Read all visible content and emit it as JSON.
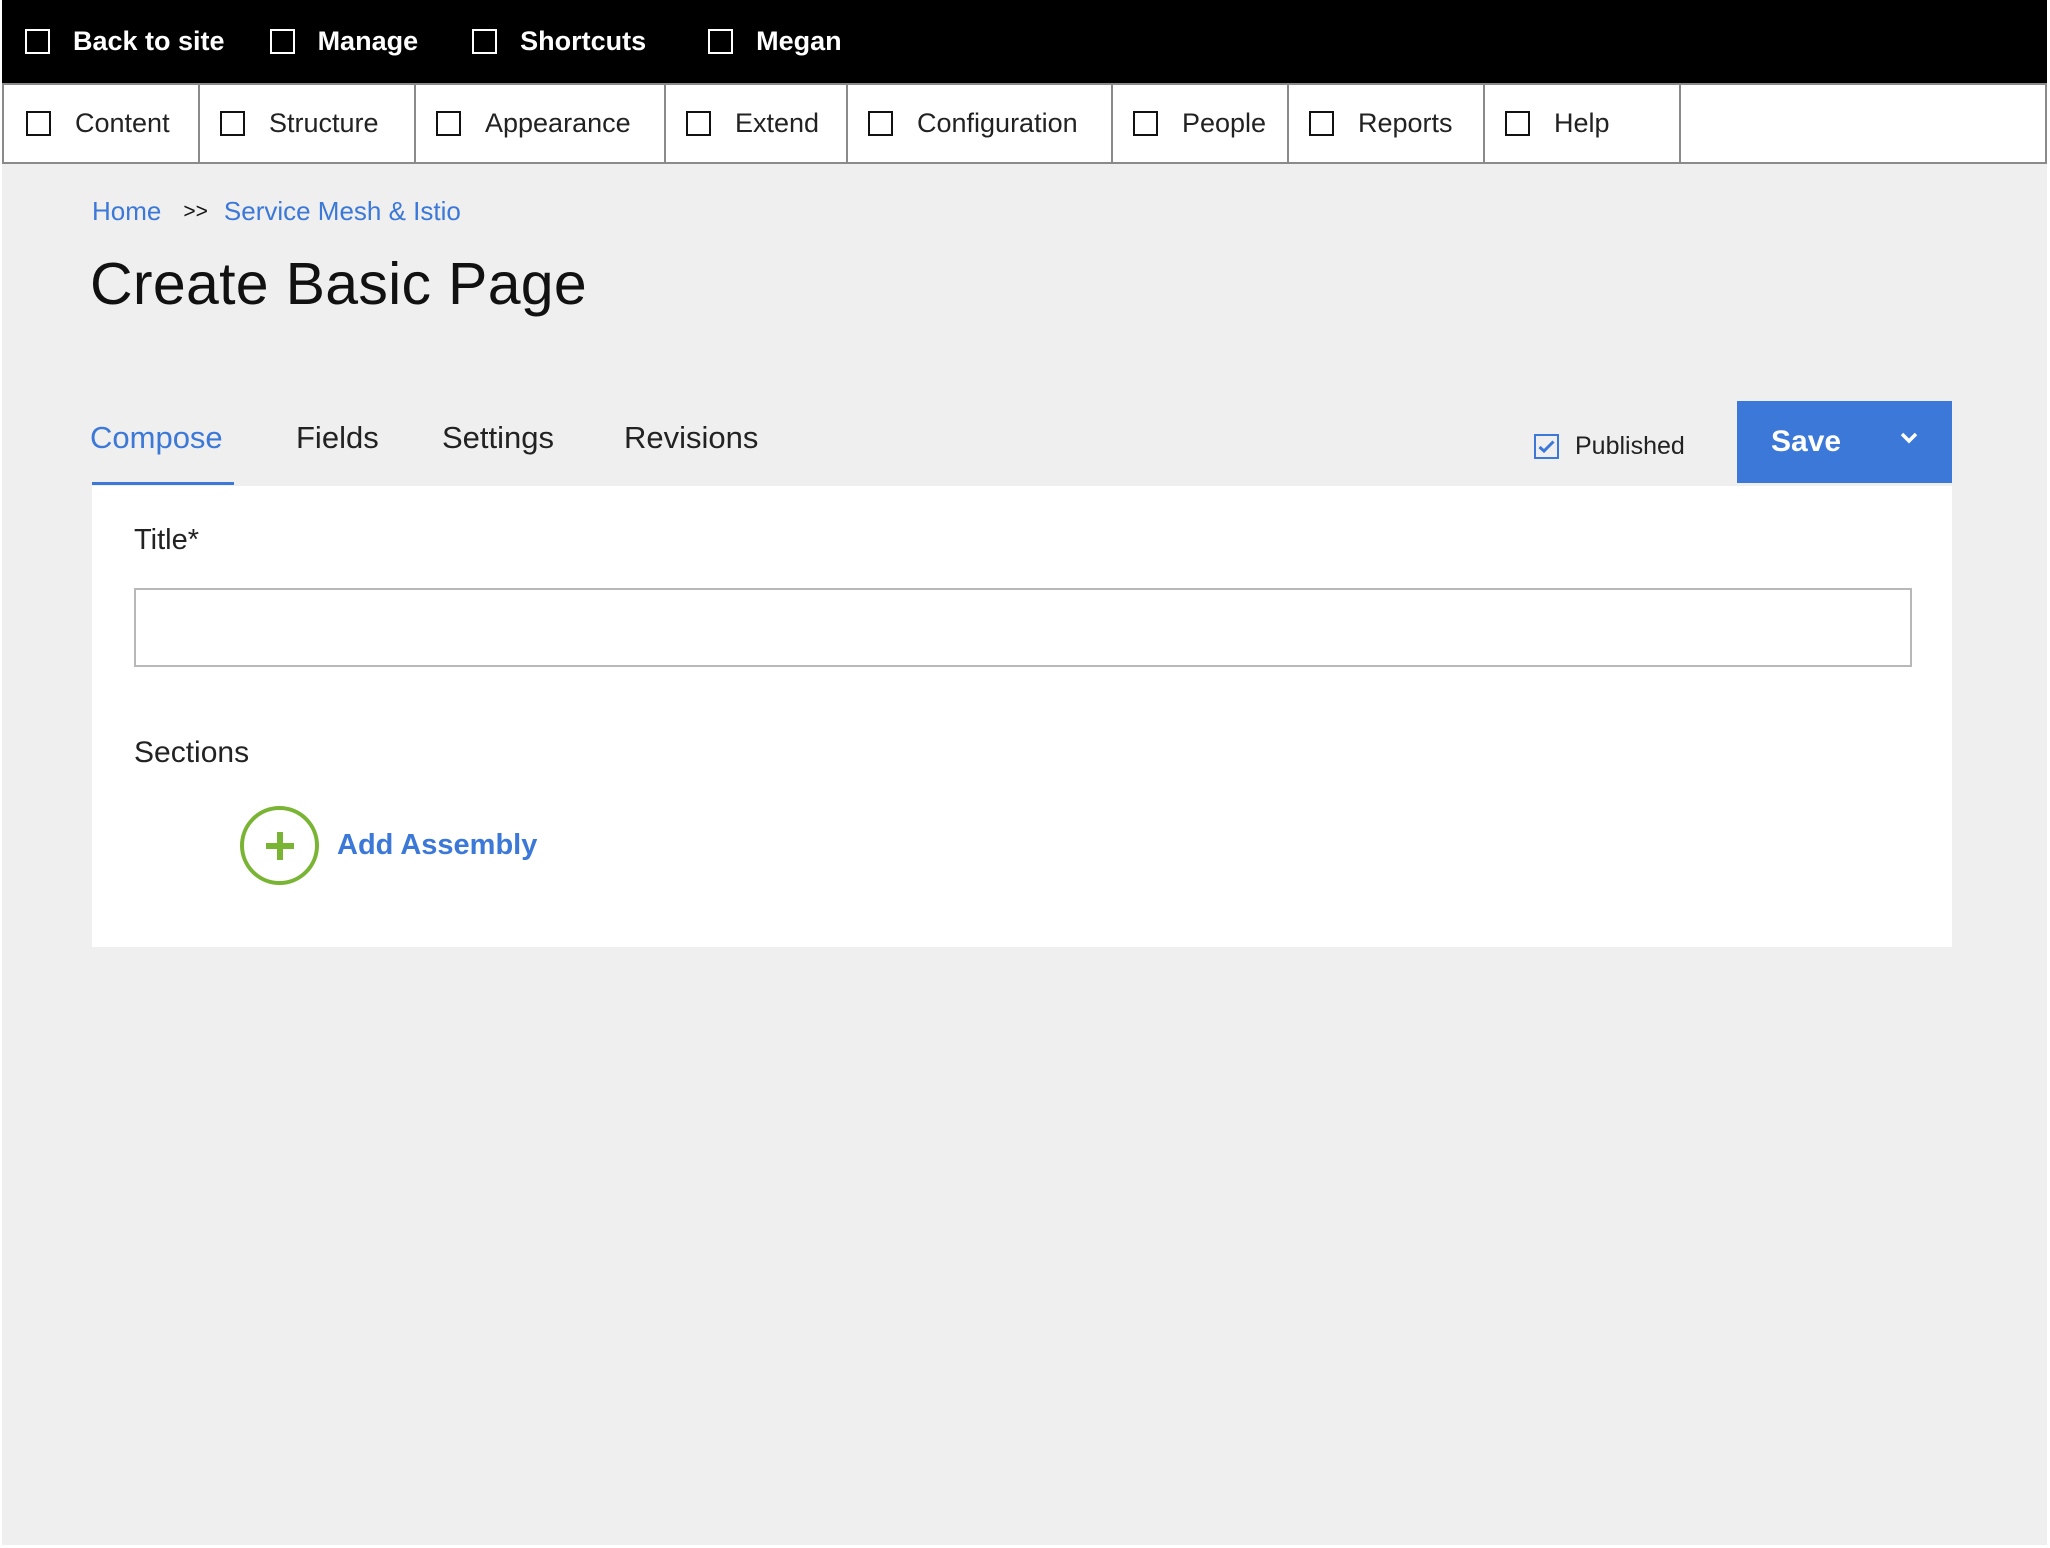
{
  "toolbar": {
    "items": [
      {
        "label": "Back to site",
        "icon": "checkbox-icon"
      },
      {
        "label": "Manage",
        "icon": "checkbox-icon"
      },
      {
        "label": "Shortcuts",
        "icon": "checkbox-icon"
      },
      {
        "label": "Megan",
        "icon": "checkbox-icon"
      }
    ]
  },
  "nav": {
    "items": [
      {
        "label": "Content"
      },
      {
        "label": "Structure"
      },
      {
        "label": "Appearance"
      },
      {
        "label": "Extend"
      },
      {
        "label": "Configuration"
      },
      {
        "label": "People"
      },
      {
        "label": "Reports"
      },
      {
        "label": "Help"
      }
    ]
  },
  "breadcrumb": {
    "home": "Home",
    "separator": ">>",
    "current": "Service Mesh & Istio"
  },
  "page": {
    "title": "Create Basic Page"
  },
  "tabs": [
    {
      "label": "Compose",
      "active": true
    },
    {
      "label": "Fields",
      "active": false
    },
    {
      "label": "Settings",
      "active": false
    },
    {
      "label": "Revisions",
      "active": false
    }
  ],
  "status": {
    "published_label": "Published",
    "published_checked": true
  },
  "actions": {
    "save_label": "Save"
  },
  "form": {
    "title_label": "Title*",
    "title_value": "",
    "title_placeholder": "",
    "sections_label": "Sections",
    "add_assembly_label": "Add Assembly"
  },
  "colors": {
    "accent": "#3b78d8",
    "add_icon": "#7ab434",
    "toolbar_bg": "#000000",
    "page_bg": "#efefef"
  }
}
